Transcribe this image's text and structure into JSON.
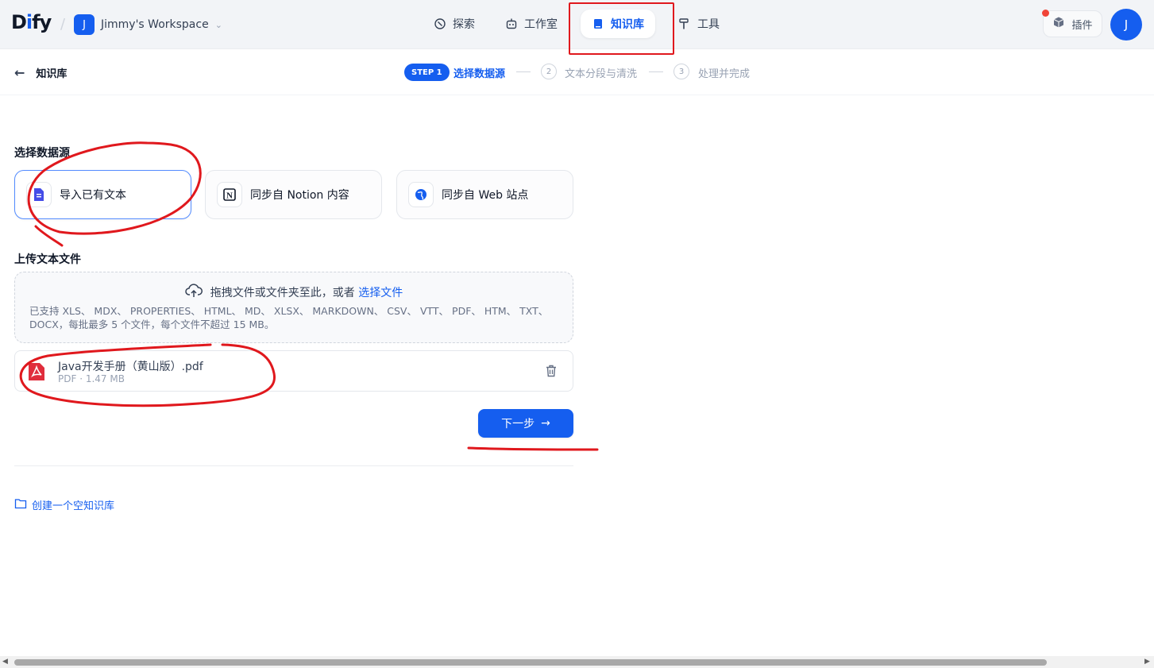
{
  "app": {
    "logo_text_a": "D",
    "logo_text_i": "i",
    "logo_text_b": "fy",
    "workspace_initial": "J",
    "workspace_name": "Jimmy's Workspace"
  },
  "nav": {
    "explore": "探索",
    "studio": "工作室",
    "knowledge": "知识库",
    "tools": "工具"
  },
  "header_right": {
    "plugins": "插件",
    "user_initial": "J"
  },
  "subheader": {
    "back_label": "知识库",
    "step1_badge": "STEP 1",
    "step1_label": "选择数据源",
    "step2_num": "2",
    "step2_label": "文本分段与清洗",
    "step3_num": "3",
    "step3_label": "处理并完成"
  },
  "data_source": {
    "title": "选择数据源",
    "options": [
      {
        "label": "导入已有文本"
      },
      {
        "label": "同步自 Notion 内容"
      },
      {
        "label": "同步自 Web 站点"
      }
    ]
  },
  "upload": {
    "title": "上传文本文件",
    "drop_text": "拖拽文件或文件夹至此，或者",
    "drop_link": "选择文件",
    "tip": "已支持 XLS、 MDX、 PROPERTIES、 HTML、 MD、 XLSX、 MARKDOWN、 CSV、 VTT、 PDF、 HTM、 TXT、 DOCX，每批最多 5 个文件，每个文件不超过 15 MB。"
  },
  "file": {
    "name": "Java开发手册（黄山版）.pdf",
    "meta": "PDF · 1.47 MB"
  },
  "actions": {
    "next": "下一步",
    "create_empty": "创建一个空知识库"
  },
  "colors": {
    "primary": "#155eef",
    "annotation_red": "#e0181d",
    "topbar_bg": "#f2f4f7"
  }
}
